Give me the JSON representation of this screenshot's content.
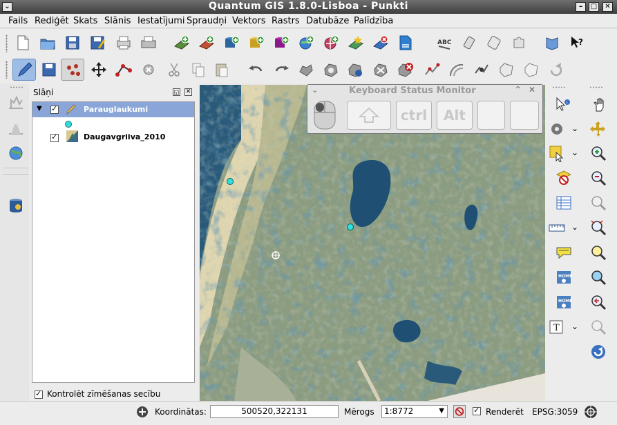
{
  "window": {
    "title": "Quantum GIS 1.8.0-Lisboa - Punkti",
    "menu_button": "⌄",
    "minimize": "–",
    "maximize": "□",
    "close": "✕"
  },
  "menu": {
    "items": [
      "Fails",
      "Rediģēt",
      "Skats",
      "Slānis",
      "Iestatījumi",
      "Spraudņi",
      "Vektors",
      "Rastrs",
      "Datubāze",
      "Palīdzība"
    ]
  },
  "toolbars": {
    "file_icons": [
      "new-project-icon",
      "open-project-icon",
      "save-project-icon",
      "save-as-icon",
      "print-composer-icon",
      "print-icon",
      "add-vector-layer-icon",
      "add-raster-layer-icon",
      "add-postgis-layer-icon",
      "add-spatialite-layer-icon",
      "add-mssql-layer-icon",
      "add-wms-layer-icon",
      "add-wfs-layer-icon",
      "new-shapefile-icon",
      "remove-layer-icon",
      "add-delimited-text-icon",
      "spellcheck-icon",
      "gps-tools-icon",
      "georeferencer-icon",
      "plugin-icon",
      "manual-icon",
      "whats-this-icon"
    ],
    "edit_icons": [
      "toggle-editing-icon",
      "save-edits-icon",
      "add-point-icon",
      "move-feature-icon",
      "node-tool-icon",
      "delete-selected-icon",
      "cut-icon",
      "copy-icon",
      "paste-icon",
      "undo-icon",
      "redo-icon",
      "simplify-icon",
      "add-ring-icon",
      "add-part-icon",
      "delete-ring-icon",
      "delete-part-icon",
      "reshape-icon",
      "offset-curve-icon",
      "split-features-icon",
      "merge-features-icon",
      "merge-attributes-icon",
      "rotate-icon"
    ]
  },
  "layers_panel": {
    "title": "Slāņi",
    "layers": [
      {
        "name": "Parauglaukumi",
        "checked": true,
        "expanded": true,
        "selected": true
      },
      {
        "name": "Daugavgriiva_2010",
        "checked": true
      }
    ],
    "control_rendering_order_label": "Kontrolēt zīmēšanas secību",
    "control_rendering_order_checked": true
  },
  "keyboard_monitor": {
    "title": "Keyboard Status Monitor",
    "keys": [
      "ctrl",
      "Alt"
    ]
  },
  "statusbar": {
    "coordinates_label": "Koordinātas:",
    "coordinates_value": "500520,322131",
    "scale_label": "Mērogs",
    "scale_value": "1:8772",
    "render_label": "Renderēt",
    "render_checked": true,
    "crs": "EPSG:3059"
  },
  "colors": {
    "title_bar": "#505050",
    "selection": "#8aa6d8",
    "point_symbol": "#2fe0e0",
    "map_water": "#1f4f73"
  }
}
